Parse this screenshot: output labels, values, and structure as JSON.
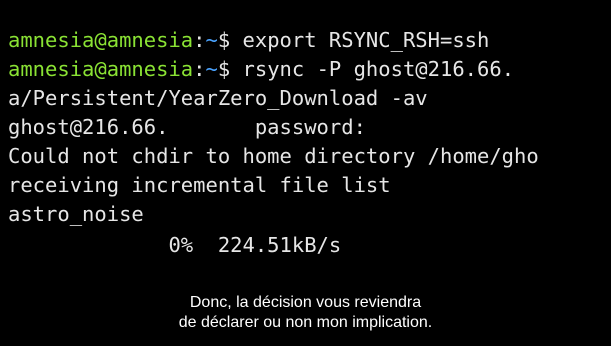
{
  "colors": {
    "background": "#000000",
    "text": "#e6e6e6",
    "prompt_user": "#8ae234",
    "prompt_path": "#4aa3ff",
    "subtitle": "#ffffff"
  },
  "terminal": {
    "lines": [
      {
        "prompt_user": "amnesia@amnesia",
        "prompt_sep": ":",
        "prompt_path": "~",
        "prompt_symbol": "$",
        "command": " export RSYNC_RSH=ssh"
      },
      {
        "prompt_user": "amnesia@amnesia",
        "prompt_sep": ":",
        "prompt_path": "~",
        "prompt_symbol": "$",
        "command": " rsync -P ghost@216.66."
      },
      {
        "text": "a/Persistent/YearZero_Download -av"
      },
      {
        "text": "ghost@216.66.       password:"
      },
      {
        "text": "Could not chdir to home directory /home/gho"
      },
      {
        "text": "receiving incremental file list"
      },
      {
        "text": "astro_noise"
      },
      {
        "text": "             0%  224.51kB/s"
      }
    ]
  },
  "subtitles": [
    "Donc, la décision vous reviendra",
    "de déclarer ou non mon implication."
  ]
}
